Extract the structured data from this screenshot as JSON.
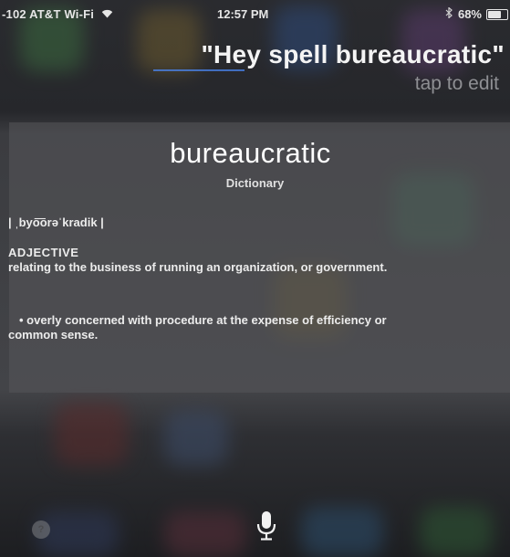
{
  "status_bar": {
    "carrier": "-102 AT&T Wi-Fi",
    "wifi_icon": "wifi-icon",
    "time": "12:57 PM",
    "bluetooth_icon": "bluetooth-icon",
    "battery_text": "68%",
    "battery_level": 0.68
  },
  "siri": {
    "query": "\"Hey spell bureaucratic\"",
    "tap_to_edit": "tap to edit"
  },
  "dictionary_card": {
    "word": "bureaucratic",
    "source": "Dictionary",
    "pronunciation": "| ˌbyo͞orəˈkradik |",
    "part_of_speech": "ADJECTIVE",
    "definition_1": "relating to the business of running an organization, or government.",
    "definition_2": "• overly concerned with procedure at the expense of efficiency or common sense."
  },
  "bottom_bar": {
    "mic_icon": "microphone-icon",
    "help_label": "?",
    "help_icon": "question-icon"
  },
  "colors": {
    "background": "#2a2b2f",
    "card": "#55565a",
    "accent_underline": "#4b8cff",
    "muted_text": "#8e8f93"
  }
}
